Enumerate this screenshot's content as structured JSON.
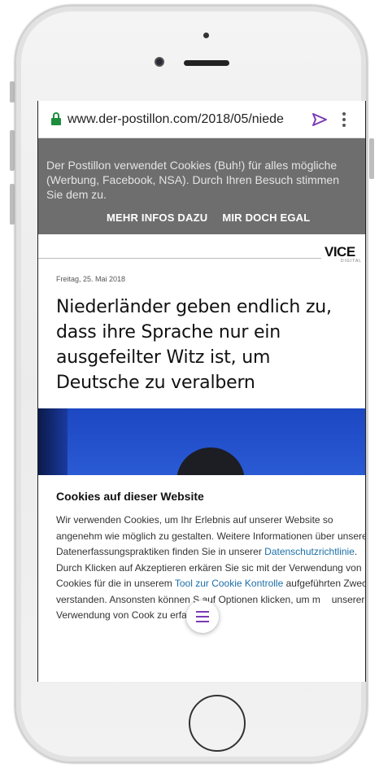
{
  "browser": {
    "url": "www.der-postillon.com/2018/05/niede",
    "icons": [
      "lock-icon",
      "send-icon",
      "more-vert-icon"
    ],
    "accent_color": "#7b3ab5",
    "lock_color": "#1e8e3e"
  },
  "cookie_banner": {
    "text": "Der Postillon verwendet Cookies (Buh!) für alles mögliche (Werbung, Facebook, NSA). Durch Ihren Besuch stimmen Sie dem zu.",
    "more_info_label": "MEHR INFOS DAZU",
    "dismiss_label": "MIR DOCH EGAL",
    "bg_color": "#6e6e6e"
  },
  "article": {
    "partner_logo": "VICE",
    "partner_sub": "DIGITAL",
    "date": "Freitag, 25. Mai 2018",
    "headline": "Niederländer geben endlich zu, dass ihre Sprache nur ein ausgefeilter Witz ist, um Deutsche zu veralbern"
  },
  "cookie_modal": {
    "title": "Cookies auf dieser Website",
    "body_1": "Wir verwenden Cookies, um Ihr Erlebnis auf unserer Website so angenehm wie möglich zu gestalten. Weitere Informationen über unsere Datenerfassungspraktiken finden Sie in unserer ",
    "link_1": "Datenschutzrichtlinie",
    "body_2": ". Durch Klicken auf Akzeptieren erkären Sie sic mit der Verwendung von Cookies für die in unserem ",
    "link_2": "Tool zur Cookie Kontrolle",
    "body_3": " aufgeführten Zwec   verstanden. Ansonsten können S auf Optionen klicken, um m     unserer Verwendung von Cook zu erfahren.",
    "link_color": "#1c6fa8"
  },
  "fab": {
    "icon": "menu-icon"
  }
}
